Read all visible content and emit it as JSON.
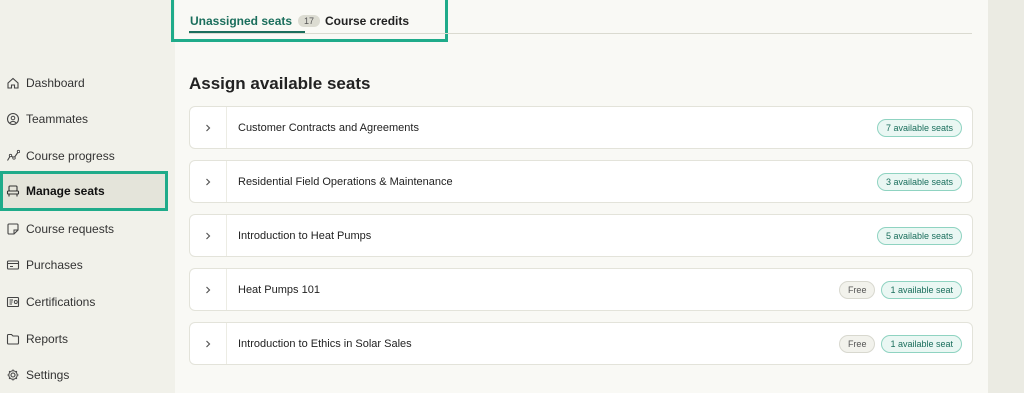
{
  "sidebar": {
    "items": [
      {
        "label": "Dashboard",
        "icon": "home-icon"
      },
      {
        "label": "Teammates",
        "icon": "user-circle-icon"
      },
      {
        "label": "Course progress",
        "icon": "progress-graph-icon"
      },
      {
        "label": "Manage seats",
        "icon": "seat-icon",
        "active": true
      },
      {
        "label": "Course requests",
        "icon": "request-icon"
      },
      {
        "label": "Purchases",
        "icon": "wallet-icon"
      },
      {
        "label": "Certifications",
        "icon": "certificate-icon"
      },
      {
        "label": "Reports",
        "icon": "folder-icon"
      },
      {
        "label": "Settings",
        "icon": "gear-icon"
      }
    ]
  },
  "tabs": {
    "unassigned_label": "Unassigned seats",
    "unassigned_count": "17",
    "credits_label": "Course credits"
  },
  "main": {
    "title": "Assign available seats",
    "courses": [
      {
        "name": "Customer Contracts and Agreements",
        "seats": "7 available seats",
        "free": ""
      },
      {
        "name": "Residential Field Operations & Maintenance",
        "seats": "3 available seats",
        "free": ""
      },
      {
        "name": "Introduction to Heat Pumps",
        "seats": "5 available seats",
        "free": ""
      },
      {
        "name": "Heat Pumps 101",
        "seats": "1 available seat",
        "free": "Free"
      },
      {
        "name": "Introduction to Ethics in Solar Sales",
        "seats": "1 available seat",
        "free": "Free"
      }
    ]
  },
  "colors": {
    "accent": "#1fab8a",
    "accent_dark": "#1a6e5c",
    "background": "#f1f1ea",
    "panel": "#f9f9f5"
  }
}
